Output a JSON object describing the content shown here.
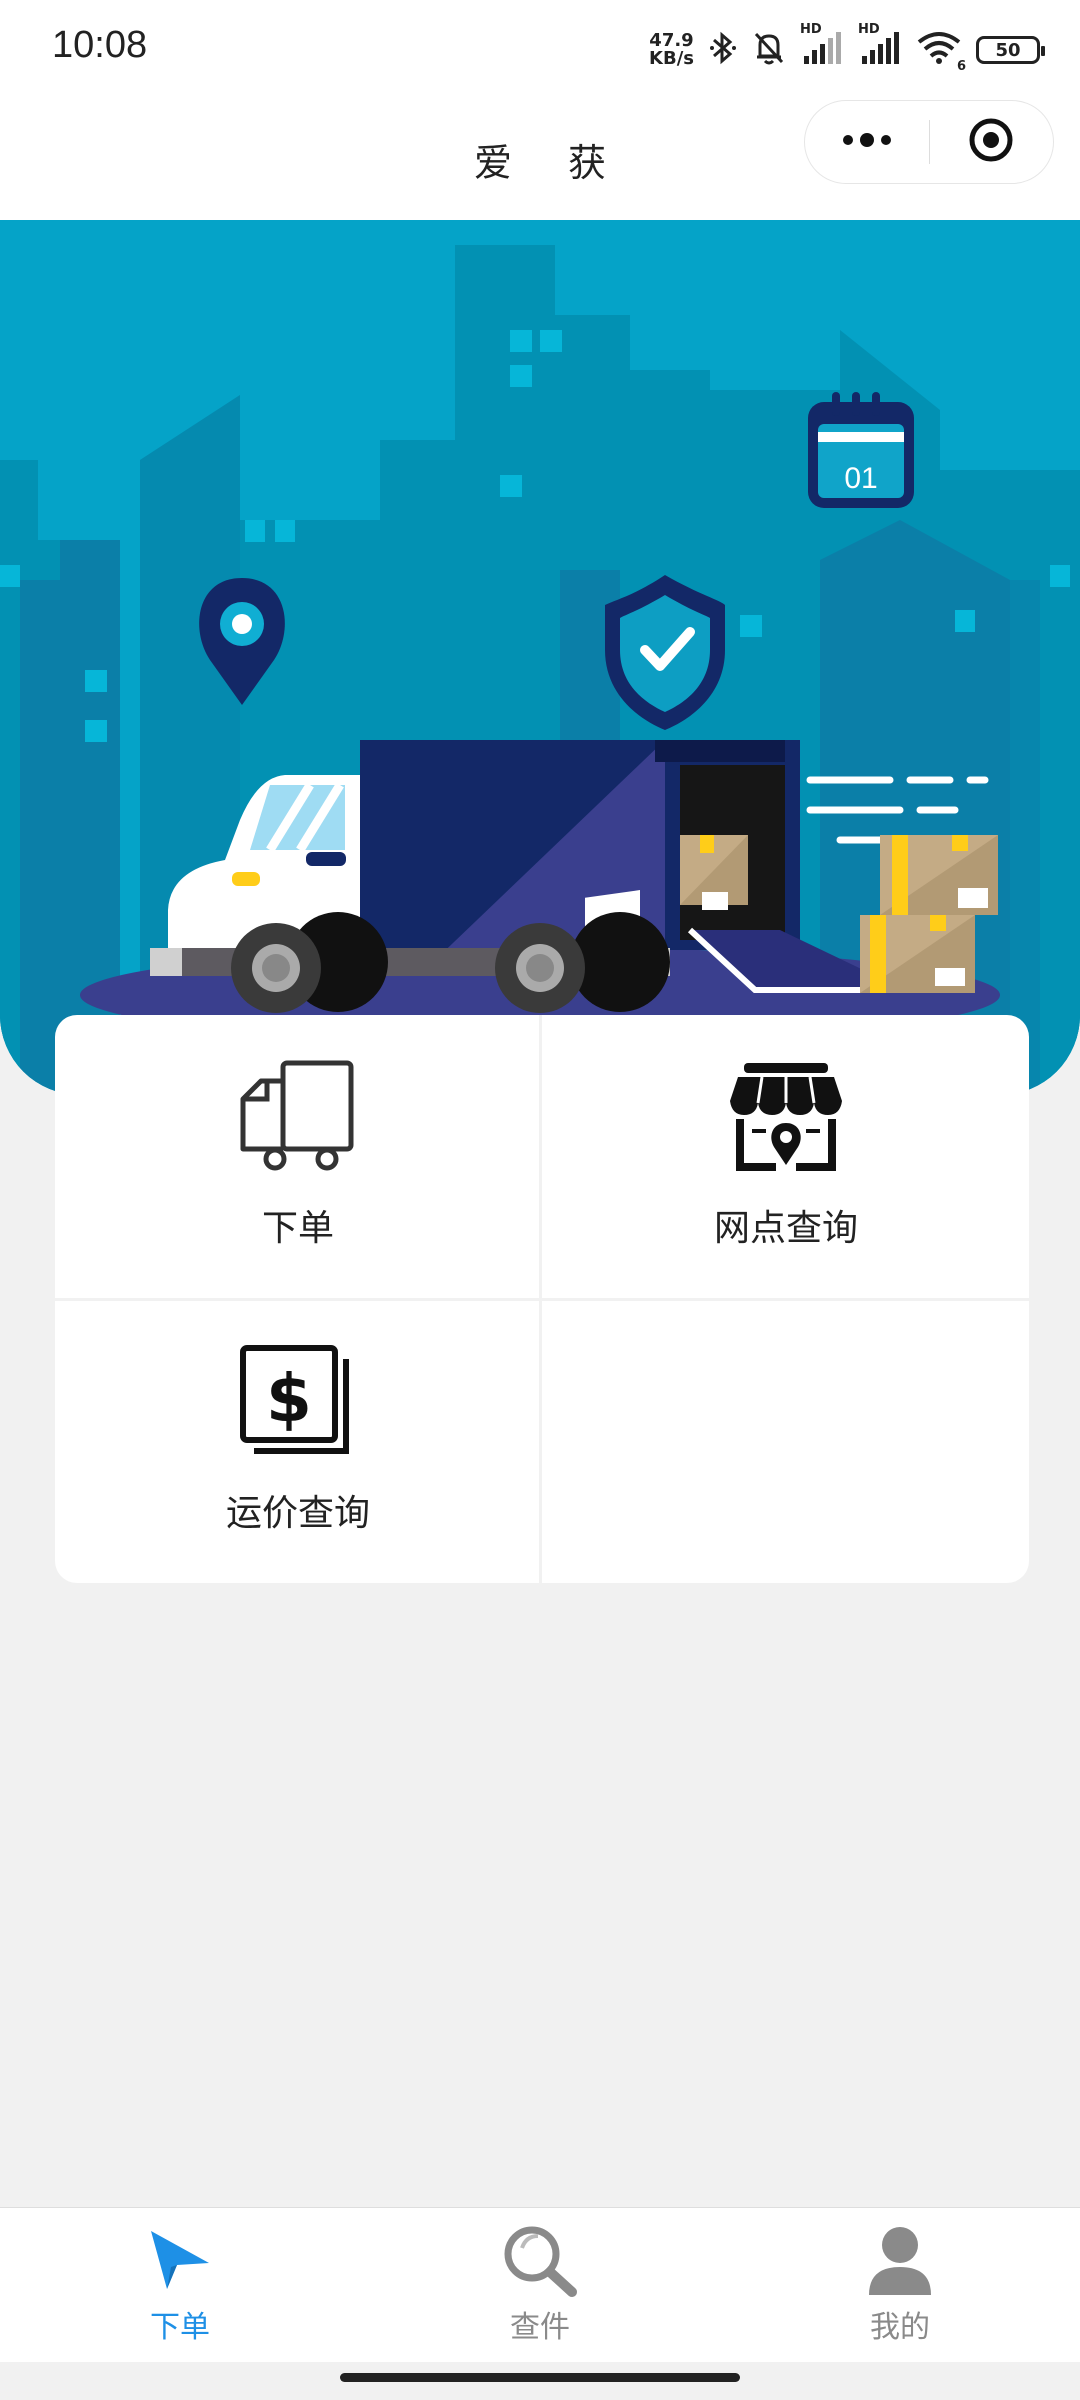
{
  "status_bar": {
    "time": "10:08",
    "net_speed_value": "47.9",
    "net_speed_unit": "KB/s",
    "signal_label_1": "HD",
    "signal_label_2": "HD",
    "wifi_sub": "6",
    "battery": "50",
    "icons": [
      "bluetooth-icon",
      "mute-bell-icon",
      "signal-icon",
      "signal-icon",
      "wifi-icon",
      "battery-icon"
    ]
  },
  "nav": {
    "title": "爱 获",
    "more_icon": "more-dots-icon",
    "close_icon": "target-close-icon"
  },
  "banner": {
    "calendar_text": "01",
    "colors": {
      "sky": "#05a3c8",
      "city": "#0291b3",
      "navy": "#132867",
      "truck_back": "#3a3f8e"
    }
  },
  "menu": {
    "items": [
      {
        "label": "下单",
        "icon": "delivery-truck-icon"
      },
      {
        "label": "网点查询",
        "icon": "store-location-icon"
      },
      {
        "label": "运价查询",
        "icon": "price-dollar-icon"
      }
    ]
  },
  "tabbar": {
    "active_color": "#1e90e6",
    "inactive_color": "#8a8a8a",
    "tabs": [
      {
        "label": "下单",
        "icon": "send-arrow-icon",
        "active": true
      },
      {
        "label": "查件",
        "icon": "search-icon",
        "active": false
      },
      {
        "label": "我的",
        "icon": "user-icon",
        "active": false
      }
    ]
  }
}
